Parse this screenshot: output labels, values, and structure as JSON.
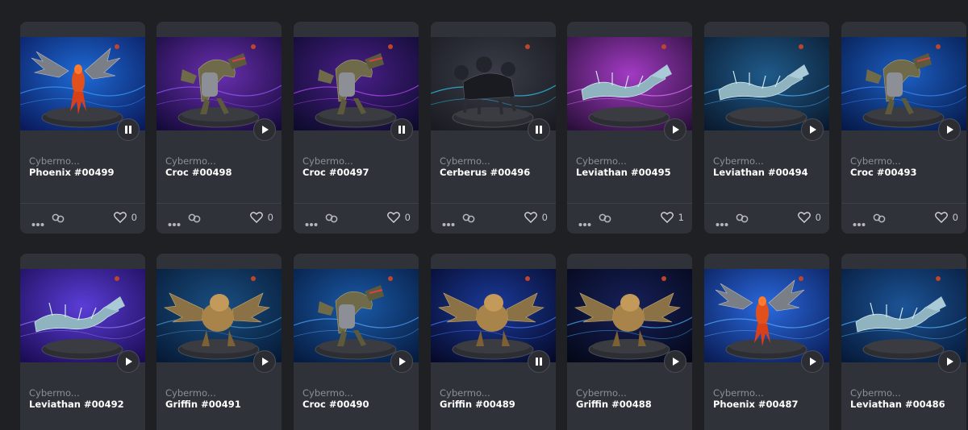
{
  "cards": [
    {
      "collection": "Cybermo...",
      "name": "Phoenix #00499",
      "likes": "0",
      "creature": "phoenix",
      "playing": true,
      "bg": [
        "#0a1a5c",
        "#1e6bd6"
      ],
      "glow": "#3da0ff"
    },
    {
      "collection": "Cybermo...",
      "name": "Croc #00498",
      "likes": "0",
      "creature": "croc",
      "playing": false,
      "bg": [
        "#150a3a",
        "#6a2fb0"
      ],
      "glow": "#9a5bff"
    },
    {
      "collection": "Cybermo...",
      "name": "Croc #00497",
      "likes": "0",
      "creature": "croc",
      "playing": true,
      "bg": [
        "#0d0b2c",
        "#4a1f8a"
      ],
      "glow": "#c04cff"
    },
    {
      "collection": "Cybermo...",
      "name": "Cerberus #00496",
      "likes": "0",
      "creature": "cerberus",
      "playing": true,
      "bg": [
        "#1a1b22",
        "#3a3d48"
      ],
      "glow": "#2ad6ff"
    },
    {
      "collection": "Cybermo...",
      "name": "Leviathan #00495",
      "likes": "1",
      "creature": "leviathan",
      "playing": false,
      "bg": [
        "#2a0f3a",
        "#a33bc4"
      ],
      "glow": "#e07bff"
    },
    {
      "collection": "Cybermo...",
      "name": "Leviathan #00494",
      "likes": "0",
      "creature": "leviathan",
      "playing": false,
      "bg": [
        "#0a1a2e",
        "#1f5a8a"
      ],
      "glow": "#5ab8ff"
    },
    {
      "collection": "Cybermo...",
      "name": "Croc #00493",
      "likes": "0",
      "creature": "croc",
      "playing": false,
      "bg": [
        "#061a4a",
        "#1c5fc4"
      ],
      "glow": "#3d8cff"
    },
    {
      "collection": "Cybermo...",
      "name": "Leviathan #00492",
      "likes": "",
      "creature": "leviathan",
      "playing": false,
      "bg": [
        "#1c0c55",
        "#5b3dd8"
      ],
      "glow": "#9a7bff"
    },
    {
      "collection": "Cybermo...",
      "name": "Griffin #00491",
      "likes": "",
      "creature": "griffin",
      "playing": false,
      "bg": [
        "#061a36",
        "#1a4f82"
      ],
      "glow": "#4a9bd8"
    },
    {
      "collection": "Cybermo...",
      "name": "Croc #00490",
      "likes": "",
      "creature": "croc",
      "playing": false,
      "bg": [
        "#061b3f",
        "#1a5aa8"
      ],
      "glow": "#5aa8ff"
    },
    {
      "collection": "Cybermo...",
      "name": "Griffin #00489",
      "likes": "",
      "creature": "griffin",
      "playing": true,
      "bg": [
        "#060a2a",
        "#1a3a9a"
      ],
      "glow": "#4a7bff"
    },
    {
      "collection": "Cybermo...",
      "name": "Griffin #00488",
      "likes": "",
      "creature": "griffin",
      "playing": false,
      "bg": [
        "#050818",
        "#16205a"
      ],
      "glow": "#4ab4ff"
    },
    {
      "collection": "Cybermo...",
      "name": "Phoenix #00487",
      "likes": "",
      "creature": "phoenix",
      "playing": false,
      "bg": [
        "#0a1c55",
        "#2a6ae0"
      ],
      "glow": "#5ab0ff"
    },
    {
      "collection": "Cybermo...",
      "name": "Leviathan #00486",
      "likes": "",
      "creature": "leviathan",
      "playing": false,
      "bg": [
        "#061a3a",
        "#1c5496"
      ],
      "glow": "#5ab8ff"
    }
  ],
  "icons": {
    "play": "play-icon",
    "pause": "pause-icon",
    "more": "more-dots-icon",
    "link": "link-icon",
    "like": "heart-icon"
  }
}
